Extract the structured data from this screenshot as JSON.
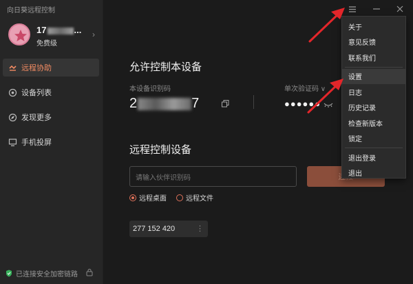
{
  "app": {
    "title": "向日葵远程控制"
  },
  "profile": {
    "name_prefix": "17",
    "name_suffix": "...",
    "tier": "免费级"
  },
  "nav": [
    {
      "label": "远程协助",
      "icon": "remote-assist-icon",
      "active": true
    },
    {
      "label": "设备列表",
      "icon": "device-list-icon",
      "active": false
    },
    {
      "label": "发现更多",
      "icon": "discover-icon",
      "active": false
    },
    {
      "label": "手机投屏",
      "icon": "screen-cast-icon",
      "active": false
    }
  ],
  "footer": {
    "status": "已连接安全加密链路"
  },
  "allow": {
    "title": "允许控制本设备",
    "id_label": "本设备识别码",
    "id_prefix": "2",
    "id_suffix": "7",
    "code_label": "单次验证码 ∨",
    "code_dots": "●●●●●●"
  },
  "remote": {
    "title": "远程控制设备",
    "input_placeholder": "请输入伙伴识别码",
    "connect_label": "连接",
    "options": [
      {
        "label": "远程桌面",
        "selected": true
      },
      {
        "label": "远程文件",
        "selected": false
      }
    ],
    "history": "277 152 420"
  },
  "menu": {
    "items": [
      {
        "label": "关于"
      },
      {
        "label": "意见反馈"
      },
      {
        "label": "联系我们"
      },
      {
        "sep": true
      },
      {
        "label": "设置",
        "highlighted": true
      },
      {
        "label": "日志"
      },
      {
        "label": "历史记录"
      },
      {
        "label": "检查新版本"
      },
      {
        "label": "锁定"
      },
      {
        "sep": true
      },
      {
        "label": "退出登录"
      },
      {
        "label": "退出"
      }
    ]
  },
  "colors": {
    "accent": "#f08a62",
    "connect_bg": "#8b4e3b",
    "annotation": "#e3262a"
  }
}
